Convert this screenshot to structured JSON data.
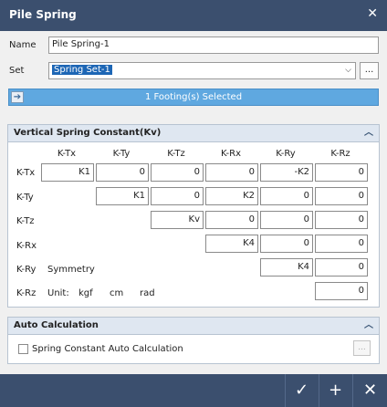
{
  "window": {
    "title": "Pile Spring",
    "close_icon": "✕"
  },
  "form": {
    "name_label": "Name",
    "name_value": "Pile Spring-1",
    "set_label": "Set",
    "set_value": "Spring Set-1",
    "set_dots": "..."
  },
  "selection": {
    "text": "1 Footing(s) Selected",
    "arrow": "➔"
  },
  "kv": {
    "header": "Vertical Spring Constant(Kv)",
    "collapse_icon": "︿",
    "columns": [
      "K-Tx",
      "K-Ty",
      "K-Tz",
      "K-Rx",
      "K-Ry",
      "K-Rz"
    ],
    "rows": [
      "K-Tx",
      "K-Ty",
      "K-Tz",
      "K-Rx",
      "K-Ry",
      "K-Rz"
    ],
    "values": {
      "r0": [
        "K1",
        "0",
        "0",
        "0",
        "-K2",
        "0"
      ],
      "r1": [
        "K1",
        "0",
        "K2",
        "0",
        "0"
      ],
      "r2": [
        "Kv",
        "0",
        "0",
        "0"
      ],
      "r3": [
        "K4",
        "0",
        "0"
      ],
      "r4": [
        "K4",
        "0"
      ],
      "r5": [
        "0"
      ]
    },
    "symmetry": "Symmetry",
    "unit_label": "Unit:",
    "unit_force": "kgf",
    "unit_length": "cm",
    "unit_angle": "rad"
  },
  "auto": {
    "header": "Auto Calculation",
    "collapse_icon": "︿",
    "checkbox_label": "Spring Constant Auto Calculation",
    "checked": false,
    "dots": "..."
  },
  "footer": {
    "ok_icon": "✓",
    "add_icon": "+",
    "cancel_icon": "✕"
  }
}
